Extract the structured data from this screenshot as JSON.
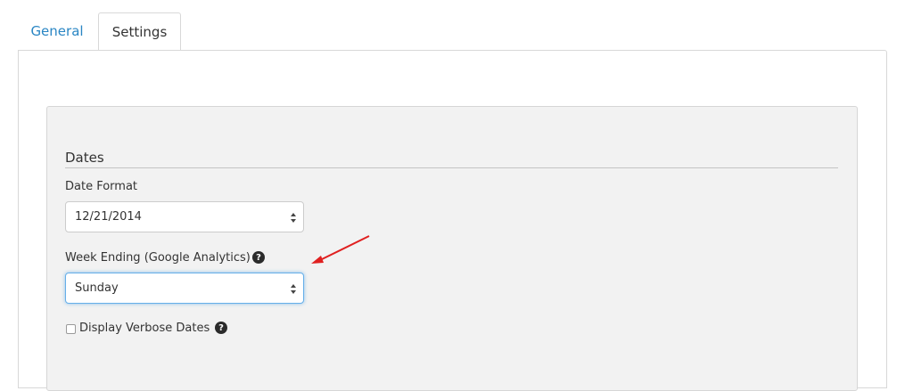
{
  "tabs": {
    "general": "General",
    "settings": "Settings"
  },
  "section": {
    "legend": "Dates"
  },
  "date_format": {
    "label": "Date Format",
    "value": "12/21/2014"
  },
  "week_ending": {
    "label": "Week Ending (Google Analytics)",
    "value": "Sunday"
  },
  "verbose_dates": {
    "label": "Display Verbose Dates",
    "checked": false
  },
  "icons": {
    "help": "question-circle-icon",
    "select_caret": "updown-caret-icon",
    "annotation": "red-arrow"
  },
  "colors": {
    "link": "#2a86c4",
    "focus": "#66afe9",
    "annotation_arrow": "#e02020"
  }
}
